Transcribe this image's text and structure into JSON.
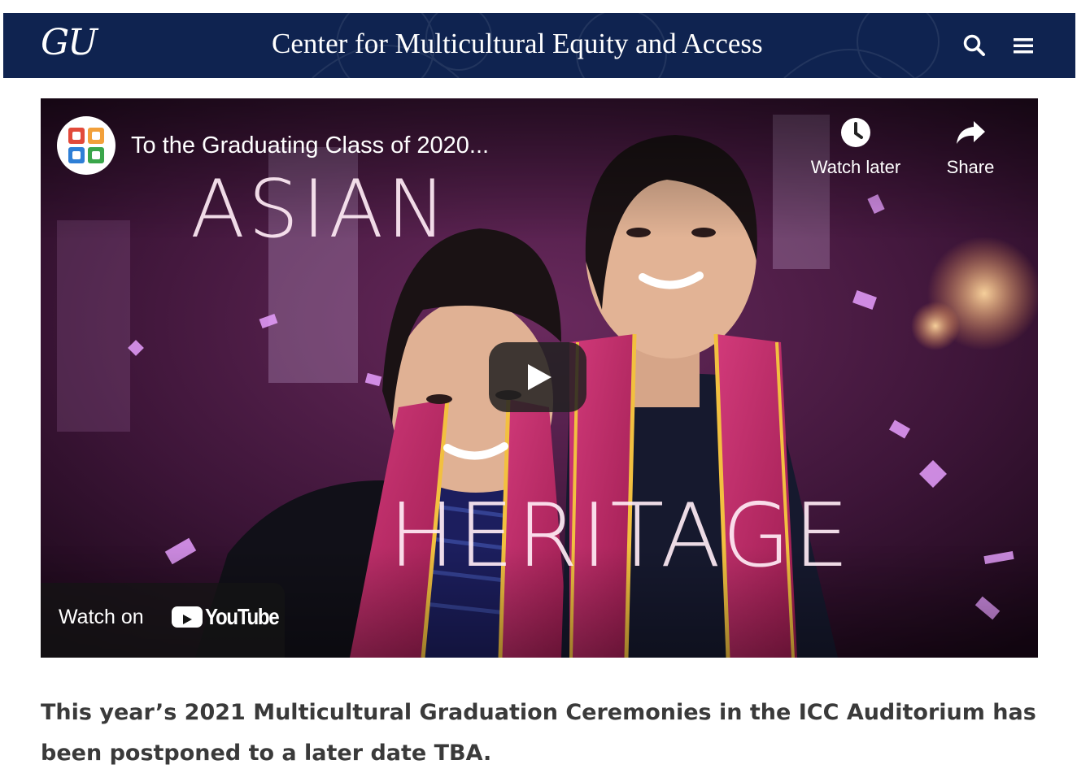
{
  "header": {
    "logo_text": "GU",
    "title": "Center for Multicultural Equity and Access",
    "search_icon": "search-icon",
    "menu_icon": "hamburger-menu-icon",
    "background_color": "#0f2350"
  },
  "video": {
    "title": "To the Graduating Class of 2020...",
    "channel_avatar_icon": "channel-logo-icon",
    "watch_later_label": "Watch later",
    "watch_later_icon": "clock-icon",
    "share_label": "Share",
    "share_icon": "share-arrow-icon",
    "overlay_word_1": "ASIAN",
    "overlay_word_2": "HERITAGE",
    "play_icon": "play-icon",
    "watch_on_label": "Watch on",
    "youtube_label": "YouTube"
  },
  "body": {
    "announcement": "This year’s 2021 Multicultural Graduation Ceremonies in the ICC Auditorium has been postponed to a later date TBA."
  }
}
